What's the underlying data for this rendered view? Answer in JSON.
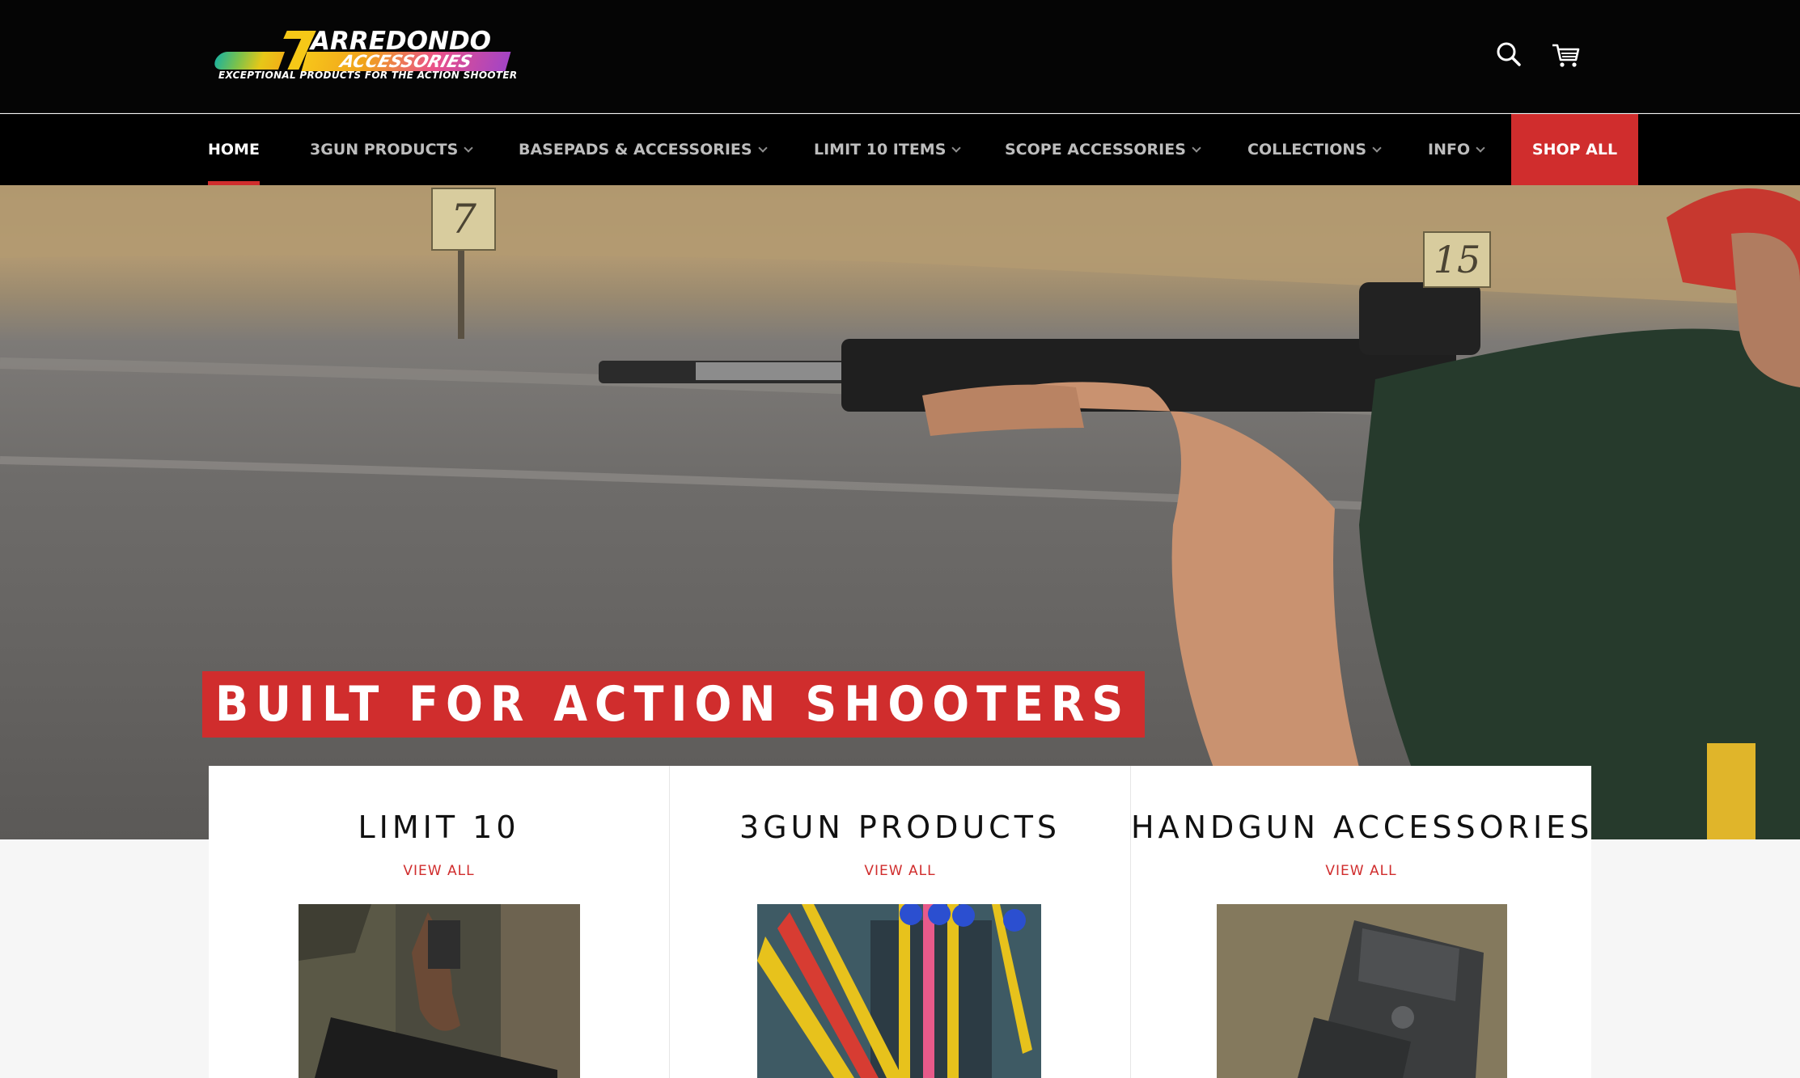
{
  "brand": {
    "name": "ARREDONDO",
    "subname": "ACCESSORIES",
    "tagline": "EXCEPTIONAL PRODUCTS FOR THE ACTION SHOOTER"
  },
  "header": {
    "icons": [
      "search-icon",
      "cart-icon"
    ]
  },
  "nav": {
    "items": [
      {
        "label": "HOME",
        "active": true
      },
      {
        "label": "3GUN PRODUCTS",
        "dropdown": true
      },
      {
        "label": "BASEPADS & ACCESSORIES",
        "dropdown": true
      },
      {
        "label": "LIMIT 10 ITEMS",
        "dropdown": true
      },
      {
        "label": "SCOPE ACCESSORIES",
        "dropdown": true
      },
      {
        "label": "COLLECTIONS",
        "dropdown": true
      },
      {
        "label": "INFO",
        "dropdown": true
      }
    ],
    "cta": "SHOP ALL"
  },
  "hero": {
    "title": "BUILT FOR ACTION SHOOTERS",
    "targets": [
      "7",
      "15"
    ]
  },
  "collections": [
    {
      "title": "LIMIT 10",
      "link": "VIEW ALL"
    },
    {
      "title": "3GUN PRODUCTS",
      "link": "VIEW ALL"
    },
    {
      "title": "HANDGUN ACCESSORIES",
      "link": "VIEW ALL"
    }
  ],
  "colors": {
    "accent": "#d02d2d",
    "header_bg": "#050505",
    "nav_bg": "#000000",
    "page_bg": "#f6f6f6"
  }
}
